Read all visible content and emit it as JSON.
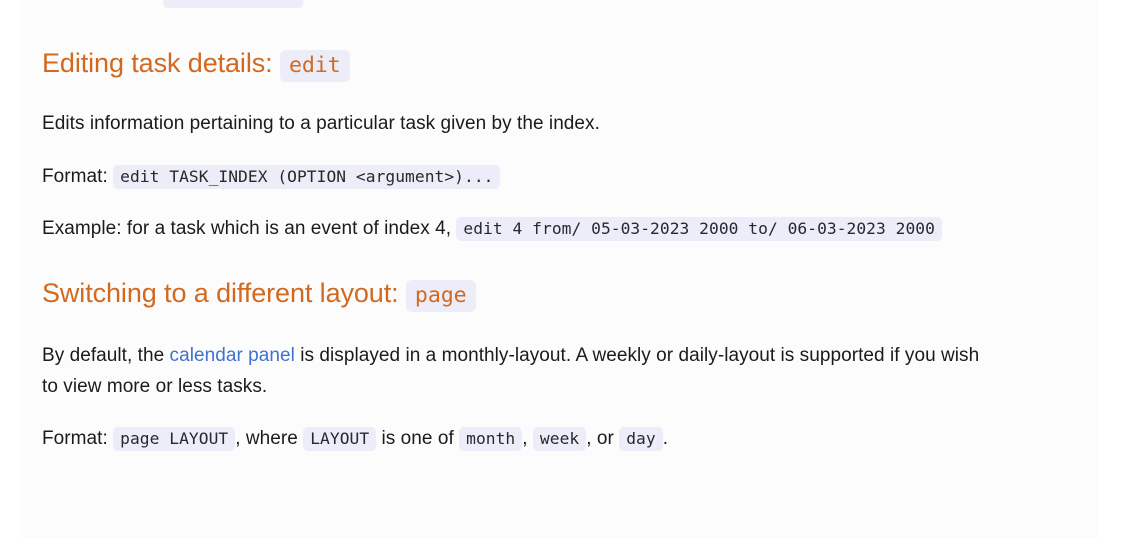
{
  "colors": {
    "heading": "#d2691e",
    "link": "#3f72cf",
    "code_background": "#ecedf8",
    "body_text": "#1b1b1b",
    "panel_background": "#fcfcfd",
    "page_background": "#ffffff"
  },
  "sections": [
    {
      "heading_text": "Editing task details:",
      "heading_code": "edit",
      "description": "Edits information pertaining to a particular task given by the index.",
      "format_label": "Format:",
      "format_code": "edit TASK_INDEX (OPTION <argument>)...",
      "example_label": "Example: for a task which is an event of index 4,",
      "example_code": "edit 4 from/ 05-03-2023 2000 to/ 06-03-2023 2000"
    },
    {
      "heading_text": "Switching to a different layout:",
      "heading_code": "page",
      "paragraph_part1": "By default, the ",
      "paragraph_link": "calendar panel",
      "paragraph_part2": " is displayed in a monthly-layout. A weekly or daily-layout is supported if you wish to view more or less tasks.",
      "format_label": "Format:",
      "format_code": "page LAYOUT",
      "format_mid1": ", where ",
      "format_code2": "LAYOUT",
      "format_mid2": " is one of ",
      "option1": "month",
      "format_sep1": ", ",
      "option2": "week",
      "format_sep2": ", or ",
      "option3": "day",
      "format_end": "."
    }
  ]
}
